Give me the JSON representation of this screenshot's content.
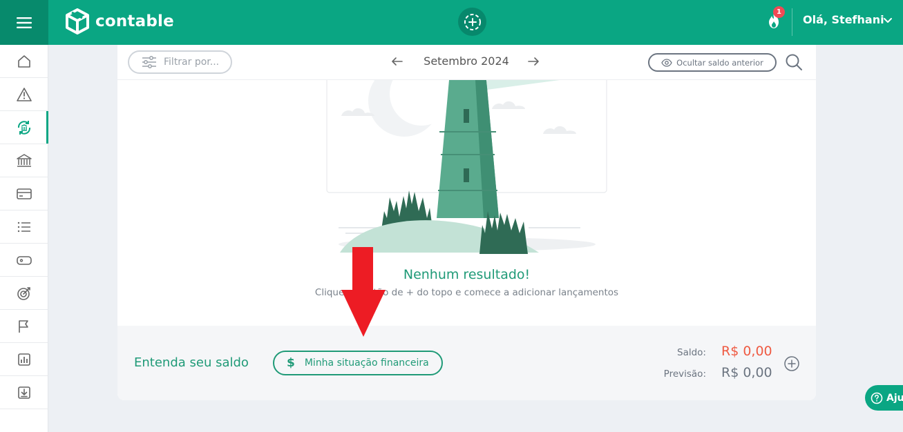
{
  "app": {
    "brand": "contable",
    "accent_color": "#0aa683",
    "notification_count": "1",
    "greeting": "Olá, Stefhani"
  },
  "sidebar": {
    "items": [
      {
        "icon": "home-icon"
      },
      {
        "icon": "warning-icon"
      },
      {
        "icon": "transactions-icon",
        "active": true
      },
      {
        "icon": "bank-icon"
      },
      {
        "icon": "credit-card-icon"
      },
      {
        "icon": "list-icon"
      },
      {
        "icon": "tag-icon"
      },
      {
        "icon": "target-icon"
      },
      {
        "icon": "flag-icon"
      },
      {
        "icon": "report-icon"
      },
      {
        "icon": "download-icon"
      }
    ]
  },
  "toolbar": {
    "filter_placeholder": "Filtrar por...",
    "month": "Setembro 2024",
    "hide_balance_label": "Ocultar saldo anterior"
  },
  "empty_state": {
    "title": "Nenhum resultado!",
    "subtitle": "Clique no botão de + do topo e comece a adicionar lançamentos",
    "subtitle_visible": "Cli              one do topo e comece a adicionar lançamentos"
  },
  "footer": {
    "heading": "Entenda seu saldo",
    "situation_button": "Minha situação financeira",
    "saldo_label": "Saldo:",
    "saldo_value": "R$ 0,00",
    "previsao_label": "Previsão:",
    "previsao_value": "R$ 0,00"
  },
  "help": {
    "label": "Aju"
  }
}
